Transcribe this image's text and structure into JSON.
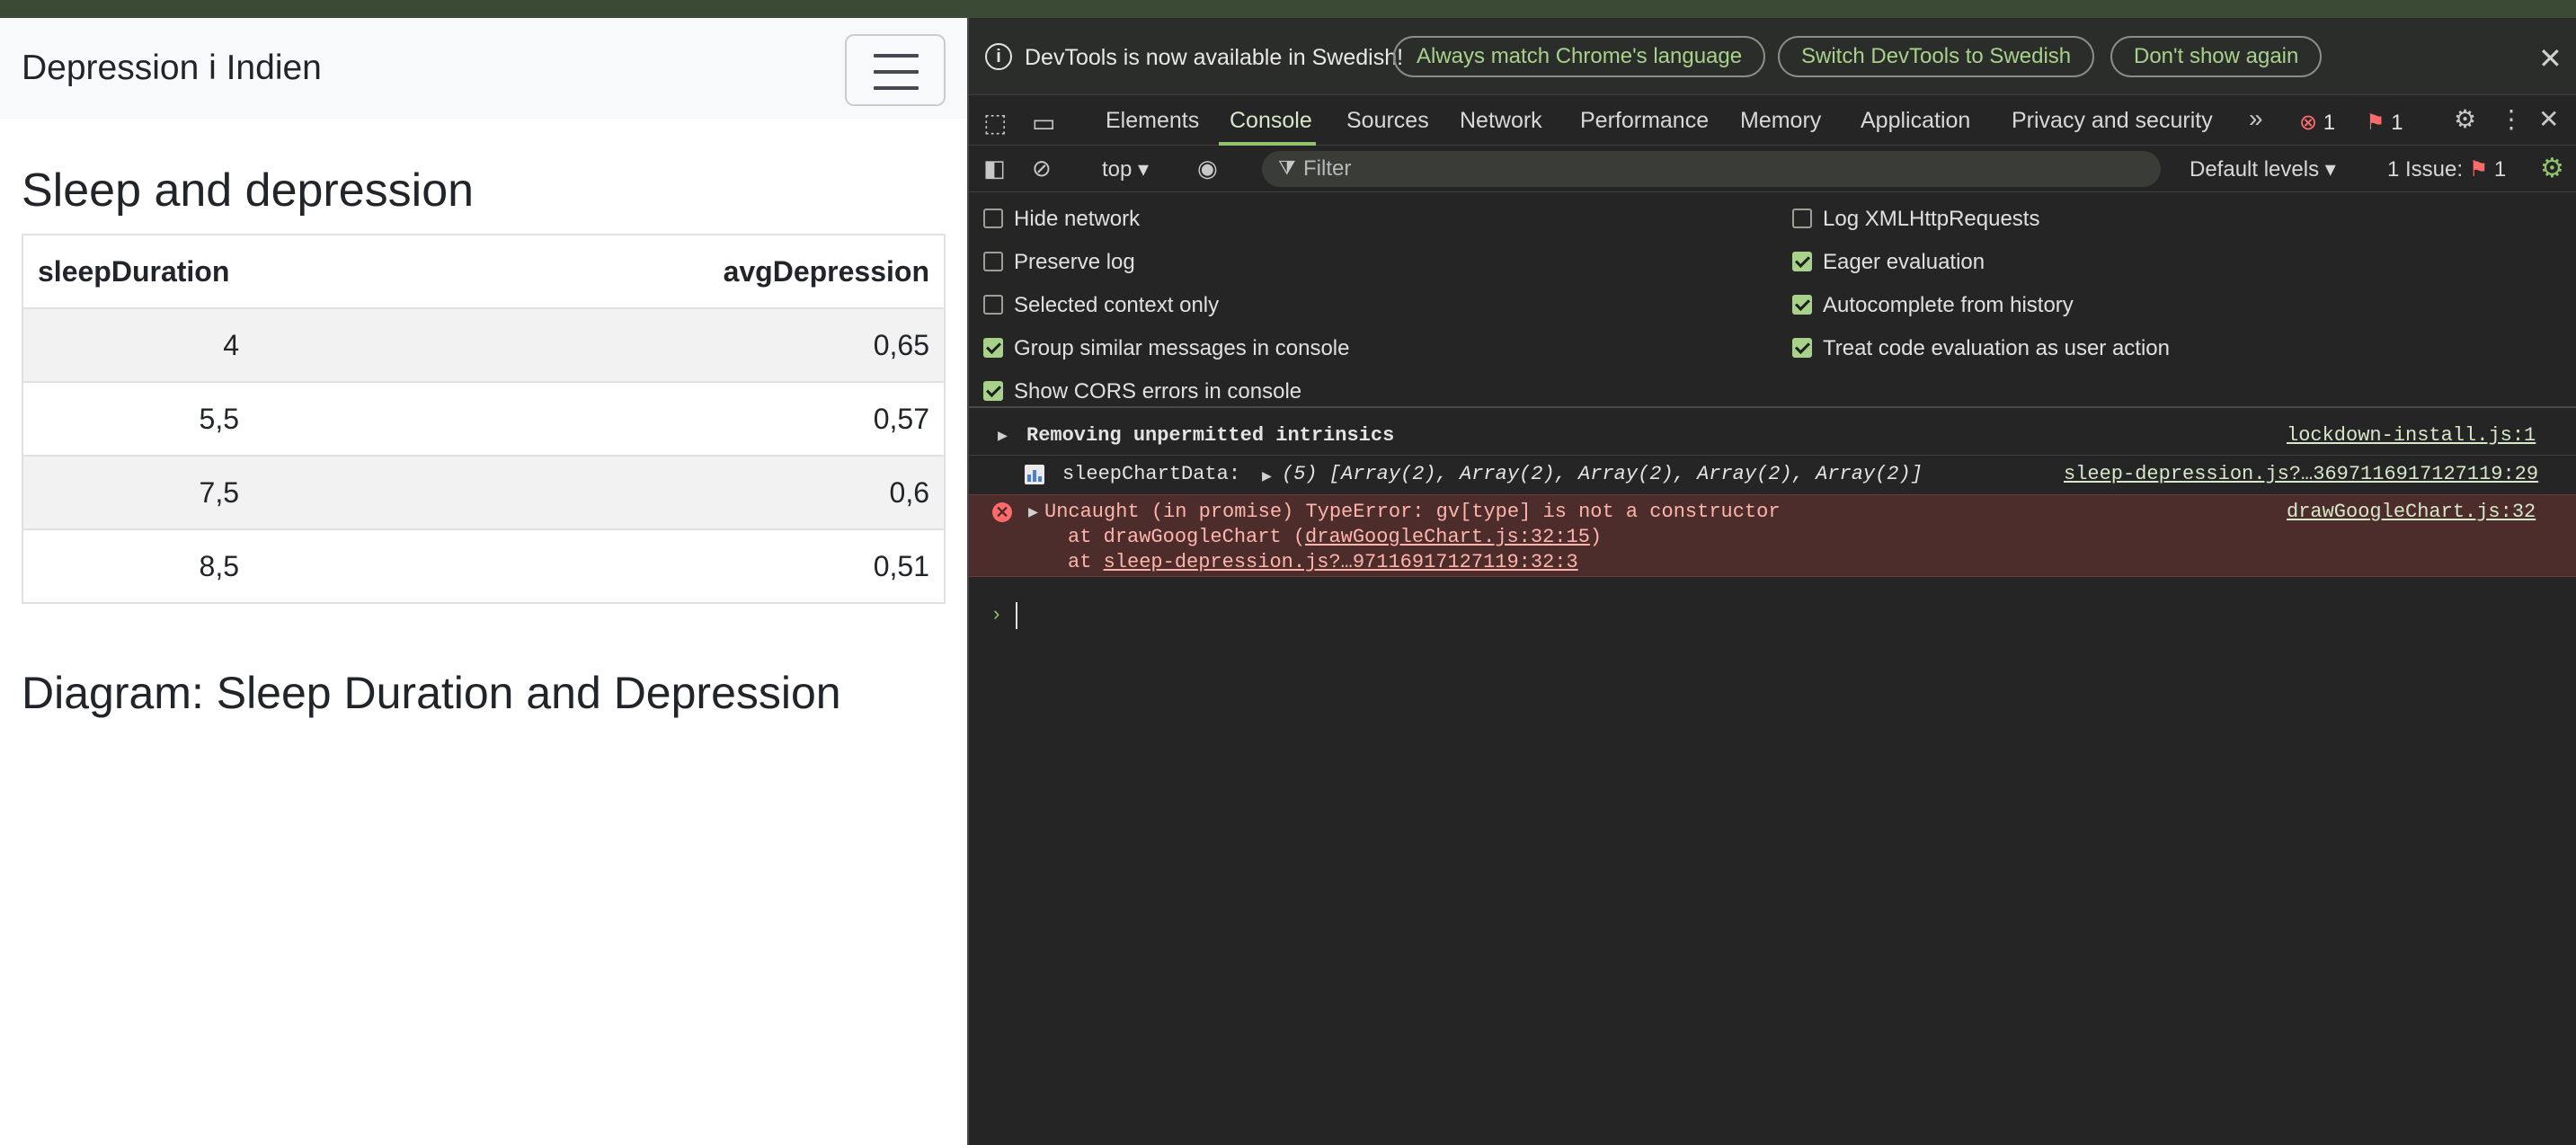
{
  "page": {
    "brand": "Depression i Indien",
    "sleep_heading": "Sleep and depression",
    "table": {
      "headers": [
        "sleepDuration",
        "avgDepression"
      ],
      "rows": [
        [
          "4",
          "0,65"
        ],
        [
          "5,5",
          "0,57"
        ],
        [
          "7,5",
          "0,6"
        ],
        [
          "8,5",
          "0,51"
        ]
      ]
    },
    "diagram_heading": "Diagram: Sleep Duration and Depression"
  },
  "devtools": {
    "infobar": {
      "text": "DevTools is now available in Swedish!",
      "btn_match": "Always match Chrome's language",
      "btn_switch": "Switch DevTools to Swedish",
      "btn_dont_show": "Don't show again"
    },
    "tabs": [
      "Elements",
      "Console",
      "Sources",
      "Network",
      "Performance",
      "Memory",
      "Application",
      "Privacy and security"
    ],
    "error_count": "1",
    "warning_count": "1",
    "toolbar": {
      "context": "top",
      "filter_placeholder": "Filter",
      "levels": "Default levels",
      "issues_label": "1 Issue:",
      "issues_count": "1"
    },
    "settings_left": [
      {
        "label": "Hide network",
        "checked": false
      },
      {
        "label": "Preserve log",
        "checked": false
      },
      {
        "label": "Selected context only",
        "checked": false
      },
      {
        "label": "Group similar messages in console",
        "checked": true
      },
      {
        "label": "Show CORS errors in console",
        "checked": true
      }
    ],
    "settings_right": [
      {
        "label": "Log XMLHttpRequests",
        "checked": false
      },
      {
        "label": "Eager evaluation",
        "checked": true
      },
      {
        "label": "Autocomplete from history",
        "checked": true
      },
      {
        "label": "Treat code evaluation as user action",
        "checked": true
      }
    ],
    "console": {
      "msg1": "Removing unpermitted intrinsics",
      "msg1_source": "lockdown-install.js:1",
      "msg2_label": "sleepChartData:",
      "msg2_value": "(5) [Array(2), Array(2), Array(2), Array(2), Array(2)]",
      "msg2_source": "sleep-depression.js?…3697116917127119:29",
      "err_line1": "Uncaught (in promise) TypeError: gv[type] is not a constructor",
      "err_line2_prefix": "at drawGoogleChart (",
      "err_line2_link": "drawGoogleChart.js:32:15",
      "err_line2_suffix": ")",
      "err_line3_prefix": "at ",
      "err_line3_link": "sleep-depression.js?…97116917127119:32:3",
      "err_source": "drawGoogleChart.js:32"
    }
  }
}
